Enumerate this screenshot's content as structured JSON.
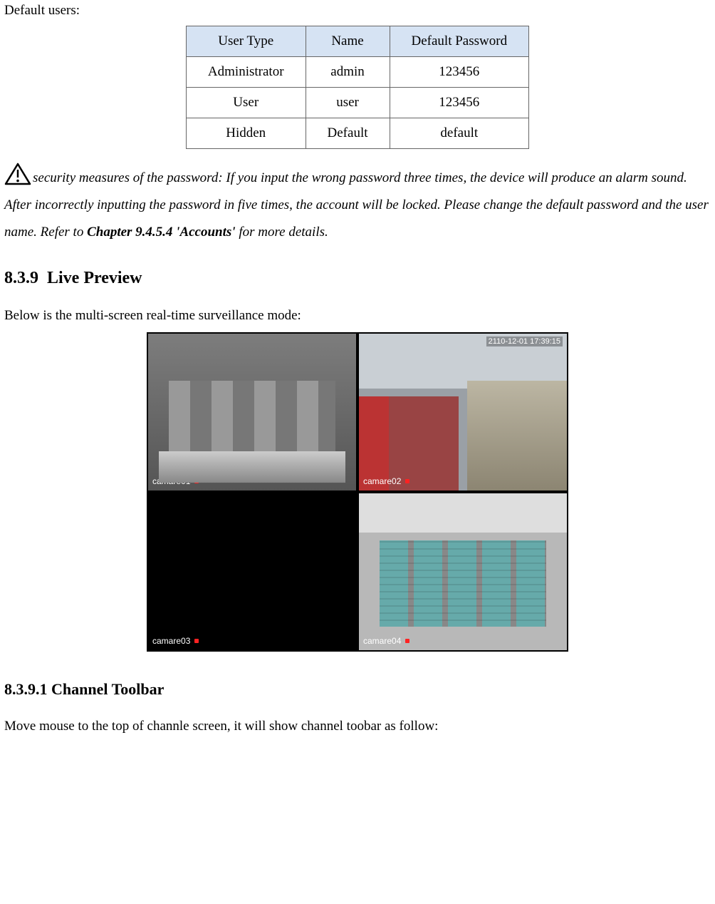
{
  "intro": "Default users:",
  "table": {
    "headers": [
      "User Type",
      "Name",
      "Default Password"
    ],
    "rows": [
      [
        "Administrator",
        "admin",
        "123456"
      ],
      [
        "User",
        "user",
        "123456"
      ],
      [
        "Hidden",
        "Default",
        "default"
      ]
    ]
  },
  "warning": {
    "text_before": "security measures of the password: If you input the wrong password three times, the device will produce an alarm sound. After incorrectly inputting the password in five times, the account will be locked. Please change the default password and the user name. Refer to ",
    "ref": "Chapter 9.4.5.4 'Accounts'",
    "text_after": " for more details."
  },
  "sections": {
    "live_preview": {
      "number": "8.3.9",
      "title": "Live Preview",
      "caption": "Below is the multi-screen real-time surveillance mode:"
    },
    "channel_toolbar": {
      "number": "8.3.9.1",
      "title": "Channel Toolbar",
      "caption": "Move mouse to the top of channle screen, it will show channel toobar as follow:"
    }
  },
  "preview": {
    "timestamp": "2110-12-01 17:39:15",
    "cells": [
      {
        "label": "camare01"
      },
      {
        "label": "camare02"
      },
      {
        "label": "camare03"
      },
      {
        "label": "camare04"
      }
    ]
  }
}
